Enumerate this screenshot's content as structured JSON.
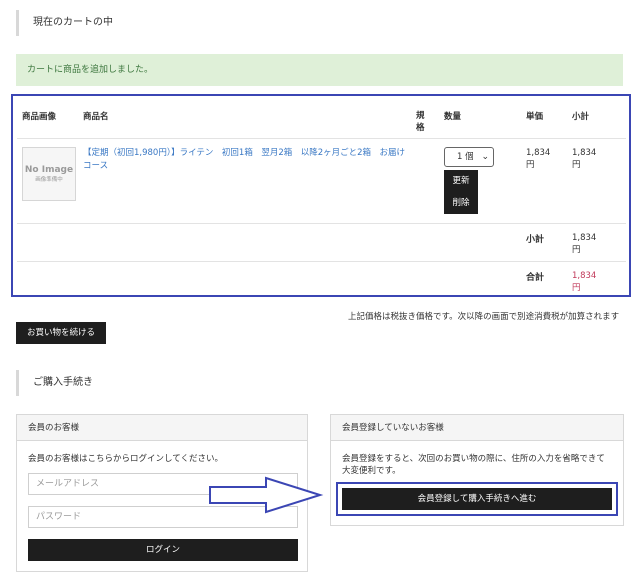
{
  "cart_heading": "現在のカートの中",
  "alert_message": "カートに商品を追加しました。",
  "cart_table": {
    "headers": {
      "image": "商品画像",
      "name": "商品名",
      "spec": "規格",
      "quantity": "数量",
      "unit_price": "単価",
      "subtotal": "小計"
    },
    "item": {
      "noimage_main": "No Image",
      "noimage_sub": "画像準備中",
      "name": "【定期（初回1,980円）】ライテン　初回1箱　翌月2箱　以降2ヶ月ごと2箱　お届けコース",
      "quantity": "1 個",
      "update_label": "更新",
      "delete_label": "削除",
      "unit_price": "1,834円",
      "subtotal": "1,834円"
    },
    "subtotal_label": "小計",
    "subtotal_value": "1,834円",
    "total_label": "合計",
    "total_value": "1,834円"
  },
  "tax_note": "上記価格は税抜き価格です。次以降の画面で別途消費税が加算されます",
  "continue_button": "お買い物を続ける",
  "checkout_heading": "ご購入手続き",
  "member_panel": {
    "title": "会員のお客様",
    "description": "会員のお客様はこちらからログインしてください。",
    "email_placeholder": "メールアドレス",
    "password_placeholder": "パスワード",
    "login_button": "ログイン"
  },
  "guest_panel": {
    "title": "会員登録していないお客様",
    "description": "会員登録をすると、次回のお買い物の際に、住所の入力を省略できて大変便利です。",
    "register_button": "会員登録して購入手続きへ進む"
  },
  "colors": {
    "highlight": "#3b46b4",
    "link": "#3a78c4",
    "total_price": "#c1395a",
    "alert_bg": "#dff0d8"
  }
}
